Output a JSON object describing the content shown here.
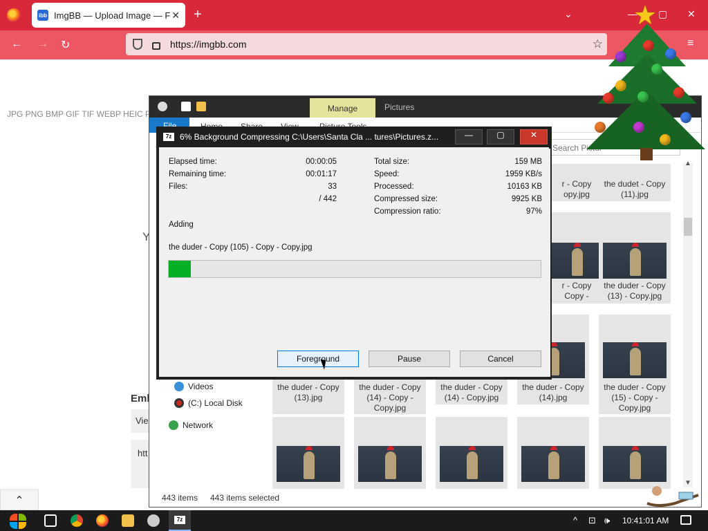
{
  "browser": {
    "tab_title": "ImgBB — Upload Image — Free",
    "favicon_text": "ibb",
    "url": "https://imgbb.com",
    "new_tab_symbol": "+",
    "close_symbol": "✕"
  },
  "page": {
    "formats_text": "JPG PNG BMP GIF TIF WEBP HEIC PD",
    "heading_fragment": "Y",
    "embed_label": "Emb",
    "view_field": "Vie",
    "code_field": "htt"
  },
  "explorer": {
    "manage_tab": "Manage",
    "pictures_label": "Pictures",
    "ribbon_tabs": [
      "File",
      "Home",
      "Share",
      "View",
      "Picture Tools"
    ],
    "search_placeholder": "Search Pictur",
    "nav_items": [
      {
        "label": "Videos",
        "icon": "video-icon"
      },
      {
        "label": "(C:) Local Disk",
        "icon": "drive-icon"
      },
      {
        "label": "Network",
        "icon": "network-icon"
      }
    ],
    "status_items": "443 items",
    "status_selected": "443 items selected",
    "tiles": [
      {
        "caption": [
          "the dudet - Copy",
          "(11).jpg"
        ]
      },
      {
        "caption": [
          "the duder - Copy",
          "(13) - Copy.jpg"
        ]
      },
      {
        "caption": [
          "the duder - Copy",
          "(13).jpg"
        ]
      },
      {
        "caption": [
          "the duder - Copy",
          "(14) - Copy -",
          "Copy.jpg"
        ]
      },
      {
        "caption": [
          "the duder - Copy",
          "(14) - Copy.jpg"
        ]
      },
      {
        "caption": [
          "the duder - Copy",
          "(14).jpg"
        ]
      },
      {
        "caption": [
          "the duder - Copy",
          "(15) - Copy -",
          "Copy.jpg"
        ]
      }
    ],
    "partial_captions": [
      "r - Copy",
      "opy.jpg",
      "r - Copy",
      "Copy -",
      "y.jpg"
    ]
  },
  "dialog": {
    "title": "6% Background Compressing C:\\Users\\Santa Cla ... tures\\Pictures.z...",
    "app_badge": "7z",
    "left_stats": [
      {
        "label": "Elapsed time:",
        "value": "00:00:05"
      },
      {
        "label": "Remaining time:",
        "value": "00:01:17"
      },
      {
        "label": "Files:",
        "value": "33"
      },
      {
        "label": "",
        "value": "/ 442"
      }
    ],
    "right_stats": [
      {
        "label": "Total size:",
        "value": "159 MB"
      },
      {
        "label": "Speed:",
        "value": "1959 KB/s"
      },
      {
        "label": "Processed:",
        "value": "10163 KB"
      },
      {
        "label": "Compressed size:",
        "value": "9925 KB"
      },
      {
        "label": "Compression ratio:",
        "value": "97%"
      }
    ],
    "status": "Adding",
    "current_file": "the duder - Copy (105) - Copy - Copy.jpg",
    "progress": 0.06,
    "buttons": {
      "foreground": "Foreground",
      "pause": "Pause",
      "cancel": "Cancel"
    }
  },
  "taskbar": {
    "clock": "10:41:01 AM",
    "tray_chevron": "^",
    "volume_symbol": "🕪"
  },
  "colors": {
    "firefox_tabbar": "#d92839",
    "firefox_navbar": "#ec5763",
    "progress_fill": "#06b025",
    "manage_tab": "#e6e39d",
    "file_tab": "#1979ca"
  }
}
